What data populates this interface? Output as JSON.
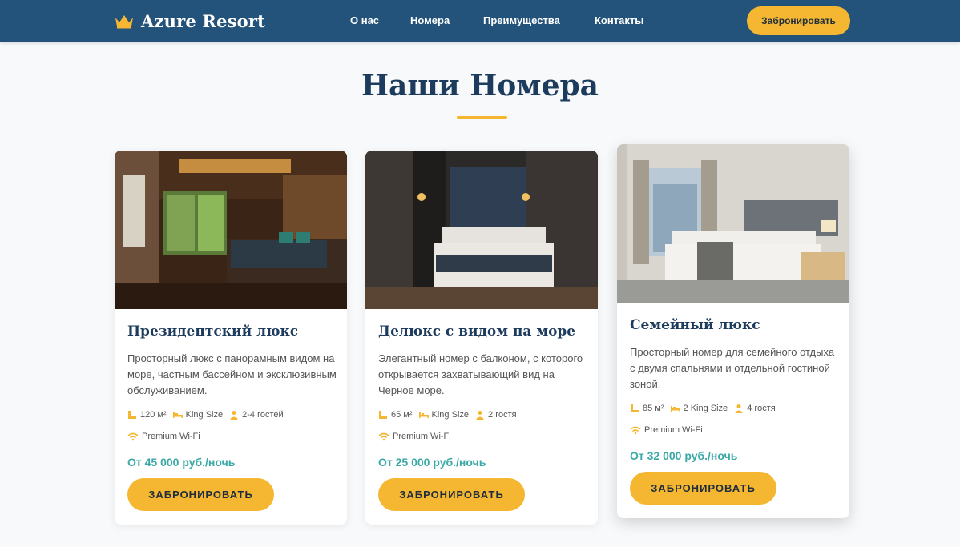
{
  "header": {
    "brand": "Azure Resort",
    "nav": [
      "О нас",
      "Номера",
      "Преимущества",
      "Контакты"
    ],
    "cta": "Забронировать"
  },
  "section": {
    "title": "Наши Номера"
  },
  "rooms": [
    {
      "title": "Президентский люкс",
      "description": "Просторный люкс с панорамным видом на море, частным бассейном и эксклюзивным обслуживанием.",
      "area": "120 м²",
      "bed": "King Size",
      "guests": "2-4 гостей",
      "wifi": "Premium Wi-Fi",
      "price": "От 45 000 руб./ночь",
      "button": "ЗАБРОНИРОВАТЬ"
    },
    {
      "title": "Делюкс с видом на море",
      "description": "Элегантный номер с балконом, с которого открывается захватывающий вид на Черное море.",
      "area": "65 м²",
      "bed": "King Size",
      "guests": "2 гостя",
      "wifi": "Premium Wi-Fi",
      "price": "От 25 000 руб./ночь",
      "button": "ЗАБРОНИРОВАТЬ"
    },
    {
      "title": "Семейный люкс",
      "description": "Просторный номер для семейного отдыха с двумя спальнями и отдельной гостиной зоной.",
      "area": "85 м²",
      "bed": "2 King Size",
      "guests": "4 гостя",
      "wifi": "Premium Wi-Fi",
      "price": "От 32 000 руб./ночь",
      "button": "ЗАБРОНИРОВАТЬ"
    }
  ],
  "colors": {
    "header": "#23527a",
    "accent": "#f5b731",
    "price": "#3aa9a6",
    "title": "#1d3b5c"
  },
  "icons": [
    "crown-icon",
    "ruler-icon",
    "bed-icon",
    "person-icon",
    "wifi-icon"
  ]
}
